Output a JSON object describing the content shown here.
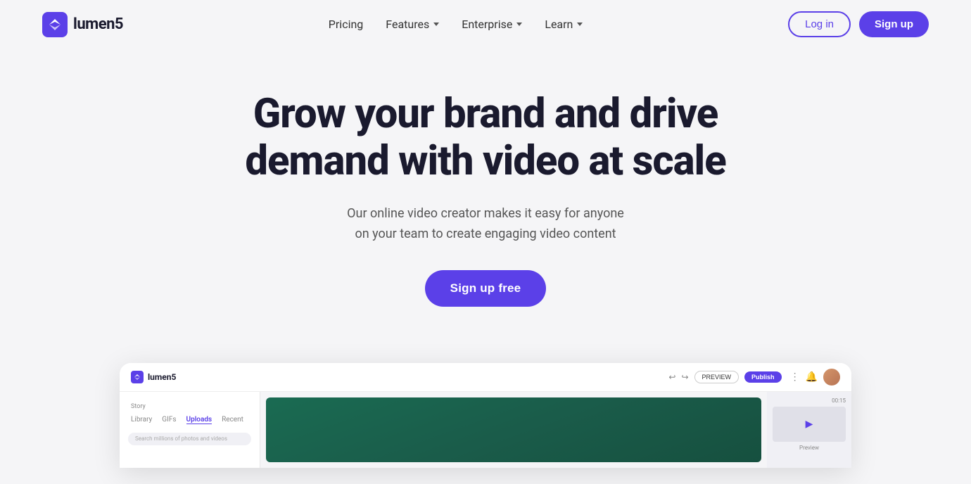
{
  "meta": {
    "title": "Lumen5 - Video Creator",
    "bg_color": "#f5f5f7",
    "brand_color": "#5b40e8"
  },
  "header": {
    "logo_text": "lumen5",
    "nav": [
      {
        "label": "Pricing",
        "has_dropdown": false
      },
      {
        "label": "Features",
        "has_dropdown": true
      },
      {
        "label": "Enterprise",
        "has_dropdown": true
      },
      {
        "label": "Learn",
        "has_dropdown": true
      }
    ],
    "login_label": "Log in",
    "signup_label": "Sign up"
  },
  "hero": {
    "title_line1": "Grow your brand and drive",
    "title_line2": "demand with video at scale",
    "subtitle_line1": "Our online video creator makes it easy for anyone",
    "subtitle_line2": "on your team to create engaging video content",
    "cta_label": "Sign up free"
  },
  "app_preview": {
    "topbar_logo": "lumen5",
    "btn_preview": "PREVIEW",
    "btn_publish": "Publish",
    "sidebar_tabs": [
      "Library",
      "GIFs",
      "Uploads",
      "Recent"
    ],
    "active_tab": "Uploads",
    "search_placeholder": "Search millions of photos and videos",
    "story_label": "Story",
    "timer": "00:15"
  }
}
